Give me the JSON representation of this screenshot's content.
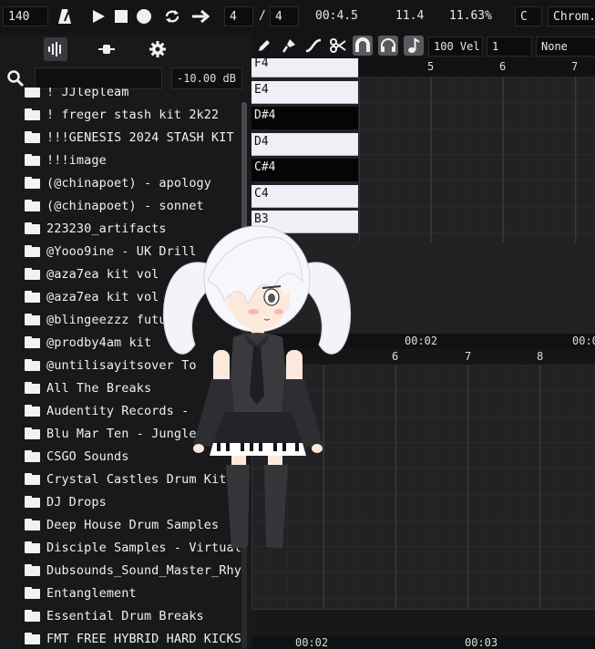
{
  "toolbar": {
    "bpm": "140",
    "time_sig_num": "4",
    "time_sig_sep": "/",
    "time_sig_den": "4",
    "position": "00:4.5",
    "cpu_a": "11.4",
    "cpu_b": "11.63%",
    "key": "C",
    "scale": "Chrom.",
    "icons": [
      "metronome-icon",
      "play-icon",
      "stop-icon",
      "record-icon",
      "loop-icon",
      "follow-arrow-icon"
    ]
  },
  "browser": {
    "tabs": [
      "samples-tab-icon",
      "plugins-tab-icon",
      "settings-gear-icon"
    ],
    "search_placeholder": "",
    "volume_readout": "-10.00 dB",
    "items": [
      "! JJlepleam",
      "! freger stash kit 2k22",
      "!!!GENESIS 2024 STASH KIT",
      "!!!image",
      "(@chinapoet) - apology",
      "(@chinapoet) - sonnet",
      "223230_artifacts",
      "@Yooo9ine - UK Drill",
      "@aza7ea kit vol",
      "@aza7ea kit vol",
      "@blingeezzz future",
      "@prodby4am kit",
      "@untilisayitsover To",
      "All The Breaks",
      "Audentity Records -",
      "Blu Mar Ten - Jungle",
      "CSGO Sounds",
      "Crystal Castles Drum Kit",
      "DJ Drops",
      "Deep House Drum Samples",
      "Disciple Samples - Virtual",
      "Dubsounds_Sound_Master_Rhythm",
      "Entanglement",
      "Essential Drum Breaks",
      "FMT FREE HYBRID HARD KICKS"
    ]
  },
  "pianoroll": {
    "tools": [
      "pencil-icon",
      "brush-icon",
      "curve-icon",
      "scissors-icon",
      "magnet-icon",
      "headphones-icon",
      "note-icon"
    ],
    "velocity": "100 Vel",
    "channel": "1",
    "snap": "None",
    "keys": [
      {
        "label": "F4",
        "color": "white"
      },
      {
        "label": "E4",
        "color": "white"
      },
      {
        "label": "D#4",
        "color": "black"
      },
      {
        "label": "D4",
        "color": "white"
      },
      {
        "label": "C#4",
        "color": "black"
      },
      {
        "label": "C4",
        "color": "white"
      },
      {
        "label": "B3",
        "color": "white"
      }
    ],
    "ruler_top": [
      "5",
      "6",
      "7"
    ],
    "ruler_mid_time": [
      "00:02",
      "00:0"
    ],
    "ruler_mid_bars": [
      "6",
      "7",
      "8"
    ],
    "ruler_bottom_time": [
      "00:02",
      "00:03"
    ]
  },
  "colors": {
    "background": "#1b1b1d",
    "panel": "#19191b",
    "grid": "#222225",
    "key_white": "#f0eef6",
    "key_black": "#050505",
    "accent_tool": "#5a5a5e"
  },
  "overlay": {
    "mascot": "twin-tail-anime-girl-mascot"
  }
}
